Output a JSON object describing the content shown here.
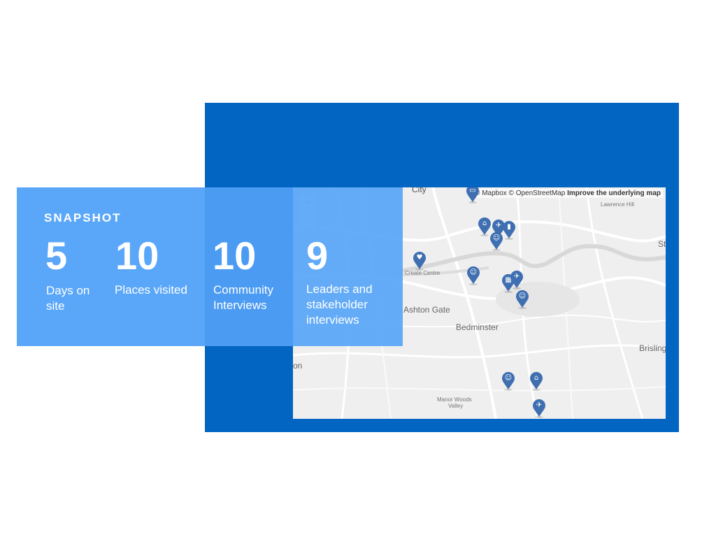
{
  "snapshot": {
    "title": "SNAPSHOT",
    "stats": [
      {
        "value": "5",
        "label_line1": "Days on",
        "label_line2": "site"
      },
      {
        "value": "10",
        "label_line1": "Places visited",
        "label_line2": ""
      },
      {
        "value": "10",
        "label_line1": "Community",
        "label_line2": "Interviews"
      },
      {
        "value": "9",
        "label_line1": "Leaders and",
        "label_line2": "stakeholder",
        "label_line3": "interviews"
      }
    ]
  },
  "map": {
    "attribution": "© Mapbox © OpenStreetMap",
    "attribution_link": "Improve the underlying map",
    "zoom_in": "+",
    "zoom_out": "−",
    "labels": {
      "lawrence_hill": "Lawrence Hill",
      "ashton_gate": "Ashton Gate",
      "bedminster": "Bedminster",
      "brislington": "Brisling",
      "create_centre": "Create Centre",
      "manor_woods": "Manor Woods",
      "valley": "Valley",
      "city": "City",
      "st": "St",
      "on": "on"
    },
    "markers": [
      {
        "icon": "ticket-icon"
      },
      {
        "icon": "museum-icon"
      },
      {
        "icon": "rocket-icon"
      },
      {
        "icon": "book-icon"
      },
      {
        "icon": "people-icon"
      },
      {
        "icon": "heart-icon"
      },
      {
        "icon": "people-icon"
      },
      {
        "icon": "building-icon"
      },
      {
        "icon": "rocket-icon"
      },
      {
        "icon": "people-icon"
      },
      {
        "icon": "people-icon"
      },
      {
        "icon": "home-icon"
      },
      {
        "icon": "rocket-icon"
      }
    ],
    "colors": {
      "marker": "#3f6fb0",
      "panel": "#0365c2",
      "card": "#5aa7f9"
    }
  }
}
